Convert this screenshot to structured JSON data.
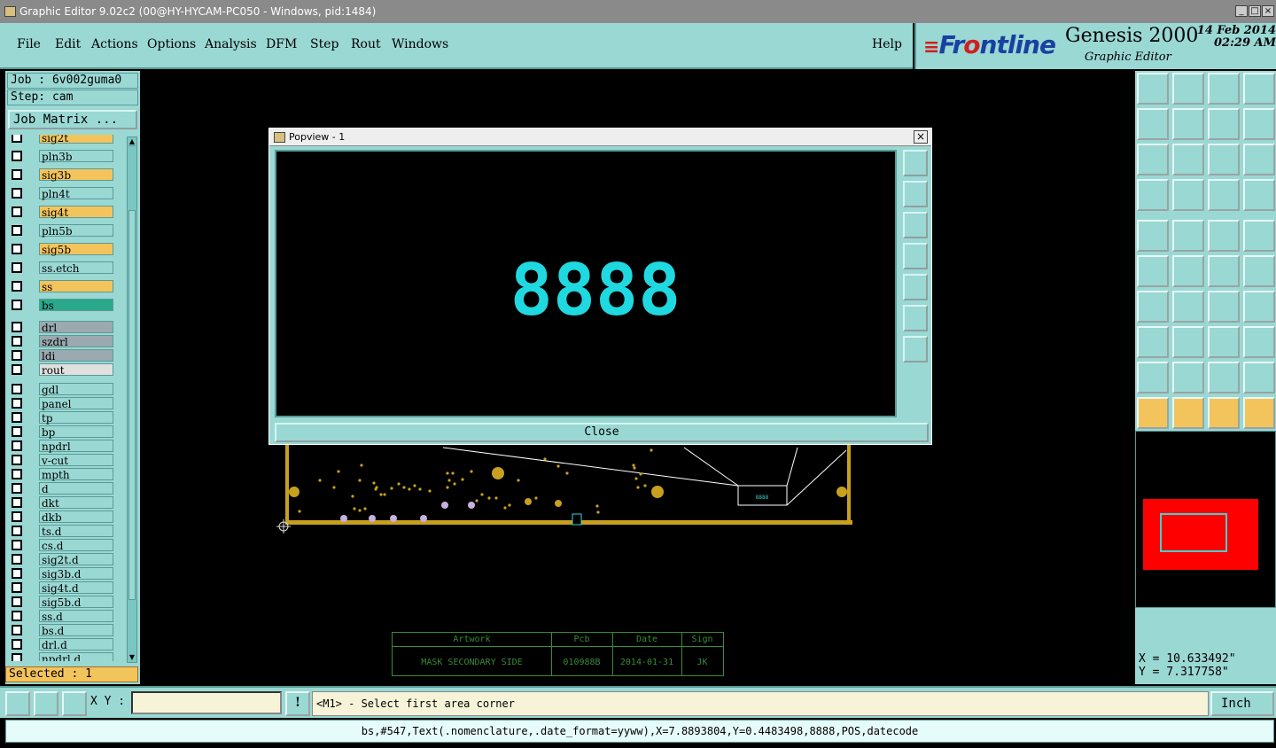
{
  "window": {
    "title": "Graphic Editor 9.02c2 (00@HY-HYCAM-PC050 - Windows, pid:1484)"
  },
  "menu": {
    "items": [
      "File",
      "Edit",
      "Actions",
      "Options",
      "Analysis",
      "DFM",
      "Step",
      "Rout",
      "Windows"
    ],
    "help": "Help"
  },
  "brand": {
    "logo_main": "Fr",
    "logo_rest": "ntline",
    "product": "Genesis 2000",
    "subtitle": "Graphic Editor",
    "date": "14 Feb 2014",
    "time": "02:29 AM"
  },
  "job": {
    "job_label": "Job : 6v002guma0",
    "step_label": "Step: cam",
    "job_matrix": "Job Matrix ..."
  },
  "layers": [
    {
      "name": "sig2t",
      "color": "#f4c45c"
    },
    {
      "name": "pln3b",
      "color": "#9ad8d4"
    },
    {
      "name": "sig3b",
      "color": "#f4c45c"
    },
    {
      "name": "pln4t",
      "color": "#9ad8d4"
    },
    {
      "name": "sig4t",
      "color": "#f4c45c"
    },
    {
      "name": "pln5b",
      "color": "#9ad8d4"
    },
    {
      "name": "sig5b",
      "color": "#f4c45c"
    },
    {
      "name": "ss.etch",
      "color": "#9ad8d4"
    },
    {
      "name": "ss",
      "color": "#f4c45c"
    },
    {
      "name": "bs",
      "color": "#2aa88a"
    },
    {
      "name": "drl",
      "color": "#9aaab0"
    },
    {
      "name": "szdrl",
      "color": "#9aaab0"
    },
    {
      "name": "ldi",
      "color": "#9aaab0"
    },
    {
      "name": "rout",
      "color": "#e0e0e0"
    },
    {
      "name": "gdl",
      "color": "#9ad8d4"
    },
    {
      "name": "panel",
      "color": "#9ad8d4"
    },
    {
      "name": "tp",
      "color": "#9ad8d4"
    },
    {
      "name": "bp",
      "color": "#9ad8d4"
    },
    {
      "name": "npdrl",
      "color": "#9ad8d4"
    },
    {
      "name": "v-cut",
      "color": "#9ad8d4"
    },
    {
      "name": "mpth",
      "color": "#9ad8d4"
    },
    {
      "name": "d",
      "color": "#9ad8d4"
    },
    {
      "name": "dkt",
      "color": "#9ad8d4"
    },
    {
      "name": "dkb",
      "color": "#9ad8d4"
    },
    {
      "name": "ts.d",
      "color": "#9ad8d4"
    },
    {
      "name": "cs.d",
      "color": "#9ad8d4"
    },
    {
      "name": "sig2t.d",
      "color": "#9ad8d4"
    },
    {
      "name": "sig3b.d",
      "color": "#9ad8d4"
    },
    {
      "name": "sig4t.d",
      "color": "#9ad8d4"
    },
    {
      "name": "sig5b.d",
      "color": "#9ad8d4"
    },
    {
      "name": "ss.d",
      "color": "#9ad8d4"
    },
    {
      "name": "bs.d",
      "color": "#9ad8d4"
    },
    {
      "name": "drl.d",
      "color": "#9ad8d4"
    },
    {
      "name": "npdrl.d",
      "color": "#9ad8d4"
    }
  ],
  "selected": "Selected : 1",
  "popview": {
    "title": "Popview - 1",
    "digits": "8888",
    "close_label": "Close"
  },
  "sheet": {
    "headers": [
      "Artwork",
      "Pcb",
      "Date",
      "Sign"
    ],
    "values": [
      "MASK SECONDARY SIDE",
      "010988B",
      "2014-01-31",
      "JK"
    ]
  },
  "coords": {
    "x": "X = 10.633492\"",
    "y": "Y =  7.317758\""
  },
  "bottom": {
    "xy_label": "X Y :",
    "prompt": "<M1> - Select first area corner",
    "unit": "Inch"
  },
  "status": "bs,#547,Text(.nomenclature,.date_format=yyww),X=7.8893804,Y=0.4483498,8888,POS,datecode"
}
